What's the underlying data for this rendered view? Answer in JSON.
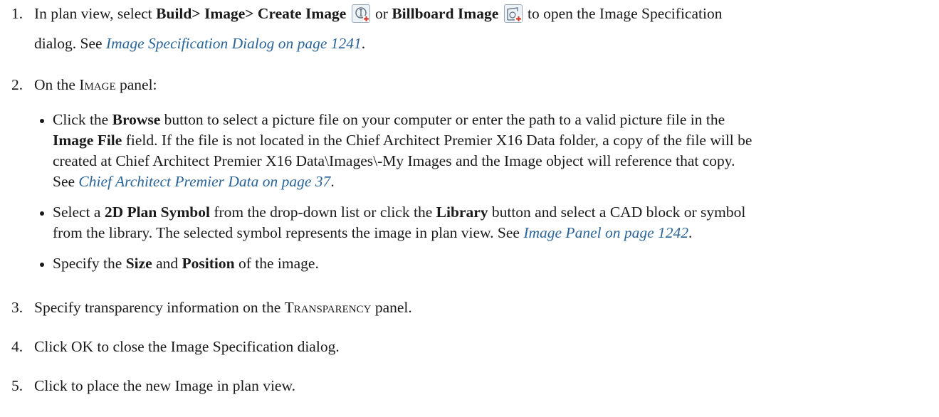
{
  "steps": [
    {
      "num": "1.",
      "pre": "In plan view, select ",
      "bold1": "Build> Image> Create Image",
      "or": " or ",
      "bold2": "Billboard Image",
      "post": " to open the Image Specification",
      "line2_pre": "dialog. See ",
      "line2_link": "Image Specification Dialog on page 1241",
      "line2_post": "."
    },
    {
      "num": "2.",
      "pre": "On the ",
      "sc": "Image",
      "post": " panel:"
    },
    {
      "num": "3.",
      "pre": "Specify transparency information on the ",
      "sc": "Transparency",
      "post": " panel."
    },
    {
      "num": "4.",
      "text": "Click OK to close the Image Specification dialog."
    },
    {
      "num": "5.",
      "text": "Click to place the new Image in plan view."
    }
  ],
  "bullets": [
    {
      "l1_pre": "Click the ",
      "l1_b1": "Browse",
      "l1_post": " button to select a picture file on your computer or enter the path to a valid picture file in the",
      "l2_b": "Image File",
      "l2_post": " field. If the file is not located in the Chief Architect Premier X16 Data folder, a copy of the file will be",
      "l3": "created at Chief Architect Premier X16 Data\\Images\\-My Images and the Image object will reference that copy.",
      "l4_pre": "See ",
      "l4_link": "Chief Architect Premier Data on page 37",
      "l4_post": "."
    },
    {
      "l1_pre": "Select a ",
      "l1_b1": "2D Plan Symbol",
      "l1_mid": " from the drop-down list or click the ",
      "l1_b2": "Library",
      "l1_post": " button and select a CAD block or symbol",
      "l2_pre": "from the library. The selected symbol represents the image in plan view. See ",
      "l2_link": "Image Panel on page 1242",
      "l2_post": "."
    },
    {
      "l1_pre": "Specify the ",
      "l1_b1": "Size",
      "l1_mid": " and ",
      "l1_b2": "Position",
      "l1_post": " of the image."
    }
  ],
  "icons": {
    "create_image": "create-image-icon",
    "billboard_image": "billboard-image-icon"
  }
}
